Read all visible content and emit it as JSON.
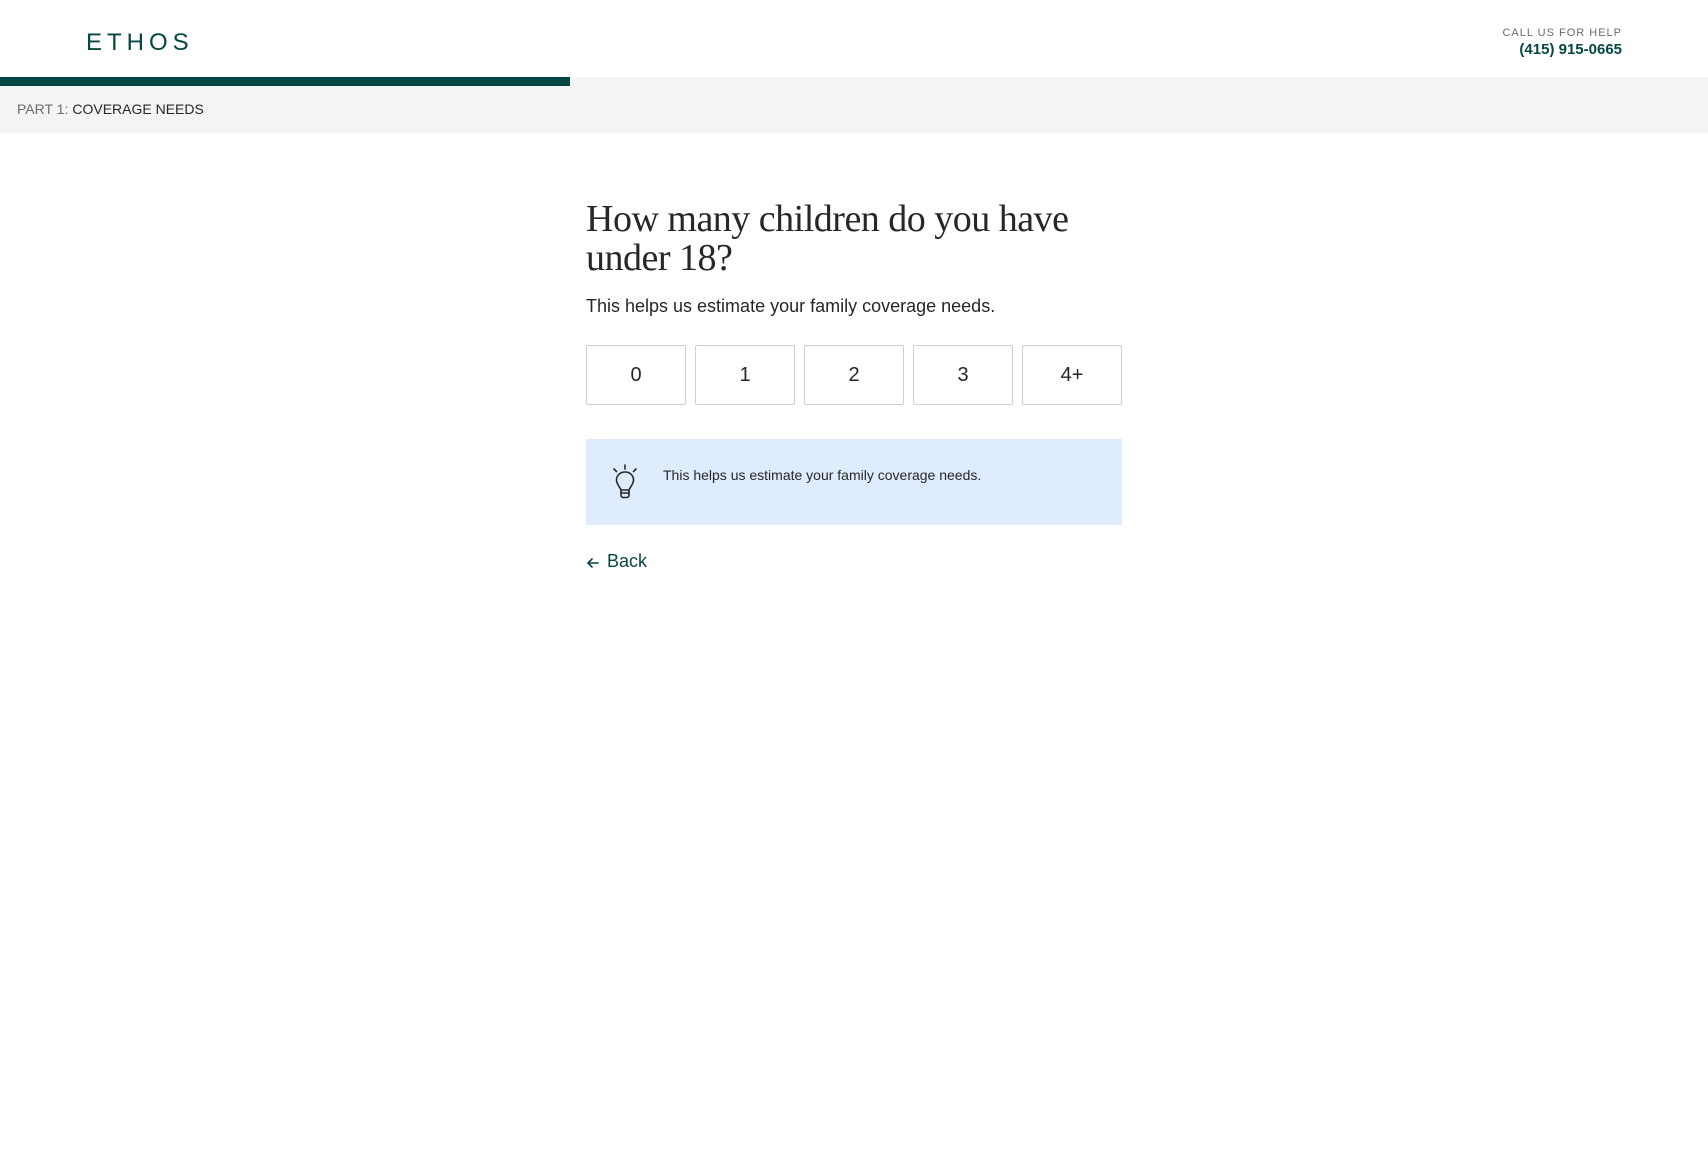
{
  "header": {
    "logo_text": "ETHOS",
    "help_label": "CALL US FOR HELP",
    "help_phone": "(415) 915-0665"
  },
  "progress": {
    "fraction": 0.334,
    "color": "#054742"
  },
  "part": {
    "prefix": "PART 1:",
    "name": "COVERAGE NEEDS"
  },
  "question": {
    "title": "How many children do you have under 18?",
    "subtitle": "This helps us estimate your family coverage needs.",
    "options": [
      "0",
      "1",
      "2",
      "3",
      "4+"
    ]
  },
  "tip": {
    "icon": "lightbulb-icon",
    "text": "This helps us estimate your family coverage needs."
  },
  "nav": {
    "back_label": "Back",
    "back_icon": "arrow-left-icon"
  },
  "colors": {
    "brand": "#054742",
    "tip_background": "#deecfd"
  }
}
